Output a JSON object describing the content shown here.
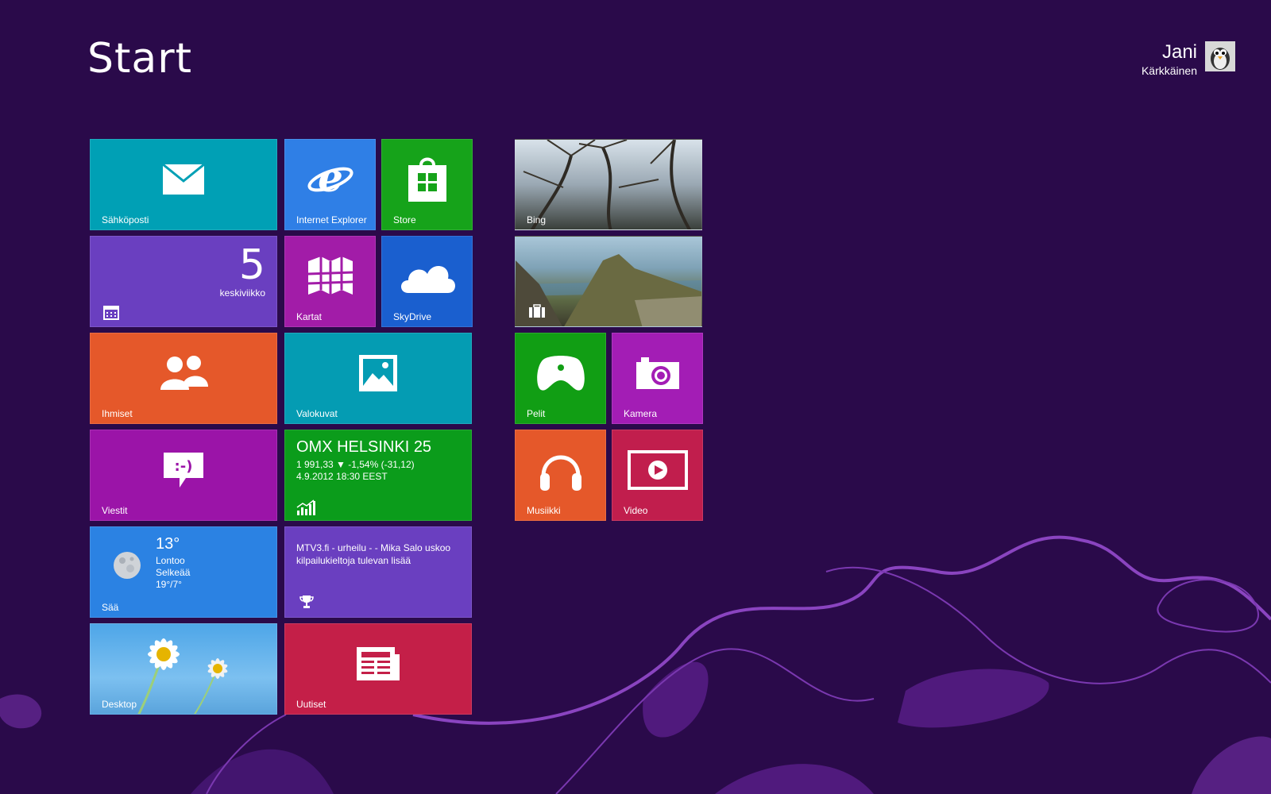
{
  "header": {
    "title": "Start"
  },
  "user": {
    "first_name": "Jani",
    "last_name": "Kärkkäinen"
  },
  "tiles": {
    "mail": {
      "label": "Sähköposti",
      "color": "#00a0b5",
      "icon": "mail-icon"
    },
    "ie": {
      "label": "Internet Explorer",
      "color": "#2f7fe6",
      "icon": "internet-explorer-icon"
    },
    "store": {
      "label": "Store",
      "color": "#16a31a",
      "icon": "store-icon"
    },
    "calendar": {
      "day_number": "5",
      "weekday": "keskiviikko",
      "color": "#6a3fc0",
      "icon": "calendar-icon"
    },
    "maps": {
      "label": "Kartat",
      "color": "#a21ca8",
      "icon": "map-icon"
    },
    "skydrive": {
      "label": "SkyDrive",
      "color": "#1a5fcf",
      "icon": "cloud-icon"
    },
    "people": {
      "label": "Ihmiset",
      "color": "#e5582a",
      "icon": "people-icon"
    },
    "photos": {
      "label": "Valokuvat",
      "color": "#049cb3",
      "icon": "photo-icon"
    },
    "messaging": {
      "label": "Viestit",
      "color": "#9b14a8",
      "icon": "chat-icon"
    },
    "finance": {
      "title": "OMX HELSINKI 25",
      "change": "1 991,33 ▼ -1,54% (-31,12)",
      "datetime": "4.9.2012 18:30 EEST",
      "color": "#0b9c1b",
      "icon": "chart-icon"
    },
    "weather": {
      "temperature": "13°",
      "city": "Lontoo",
      "condition": "Selkeää",
      "range": "19°/7°",
      "label": "Sää",
      "color": "#2b82e3",
      "icon": "moon-icon"
    },
    "sports": {
      "headline": "MTV3.fi - urheilu -  - Mika Salo uskoo kilpailukieltoja tulevan lisää",
      "color": "#6a3fc0",
      "icon": "trophy-icon"
    },
    "desktop": {
      "label": "Desktop"
    },
    "news": {
      "label": "Uutiset",
      "color": "#c41f48",
      "icon": "newspaper-icon"
    },
    "bing": {
      "label": "Bing"
    },
    "travel": {
      "icon": "suitcase-icon"
    },
    "games": {
      "label": "Pelit",
      "color": "#119e14",
      "icon": "gamepad-icon"
    },
    "camera": {
      "label": "Kamera",
      "color": "#a31db5",
      "icon": "camera-icon"
    },
    "music": {
      "label": "Musiikki",
      "color": "#e5582a",
      "icon": "headphones-icon"
    },
    "video": {
      "label": "Video",
      "color": "#c11e4d",
      "icon": "video-icon"
    }
  }
}
